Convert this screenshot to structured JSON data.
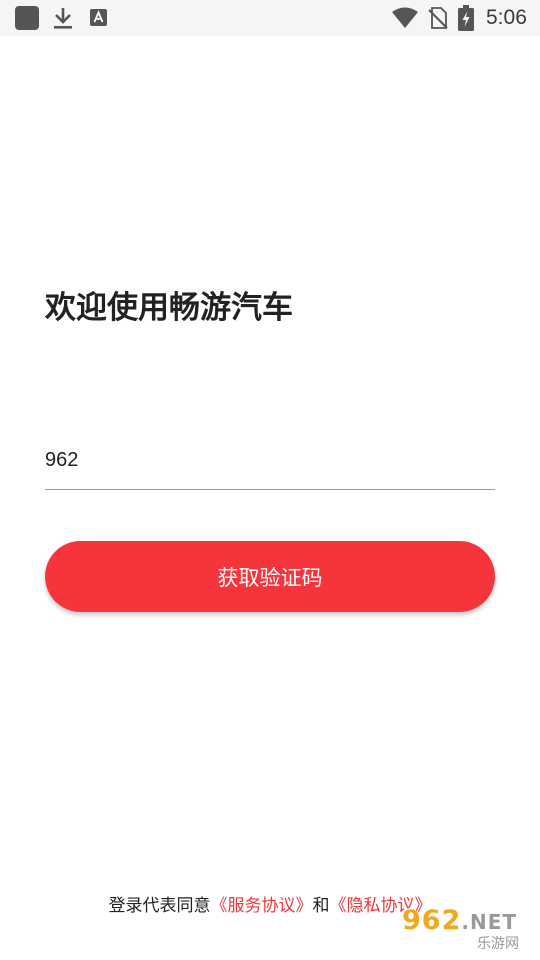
{
  "status_bar": {
    "time": "5:06",
    "icons": [
      "app-icon",
      "download-icon",
      "a-text-icon",
      "wifi-icon",
      "no-sim-icon",
      "battery-charging-icon"
    ]
  },
  "welcome": {
    "title": "欢迎使用畅游汽车"
  },
  "phone_input": {
    "value": "962"
  },
  "button": {
    "label": "获取验证码"
  },
  "agreement": {
    "prefix": "登录代表同意",
    "service_link": "《服务协议》",
    "conjunction": "和",
    "privacy_link": "《隐私协议》"
  },
  "watermark": {
    "top": "962",
    "net": ".NET",
    "bottom": "乐游网"
  },
  "colors": {
    "accent": "#f5353b",
    "link": "#e8383d",
    "status_bar_bg": "#f5f5f5",
    "text": "#222222"
  }
}
